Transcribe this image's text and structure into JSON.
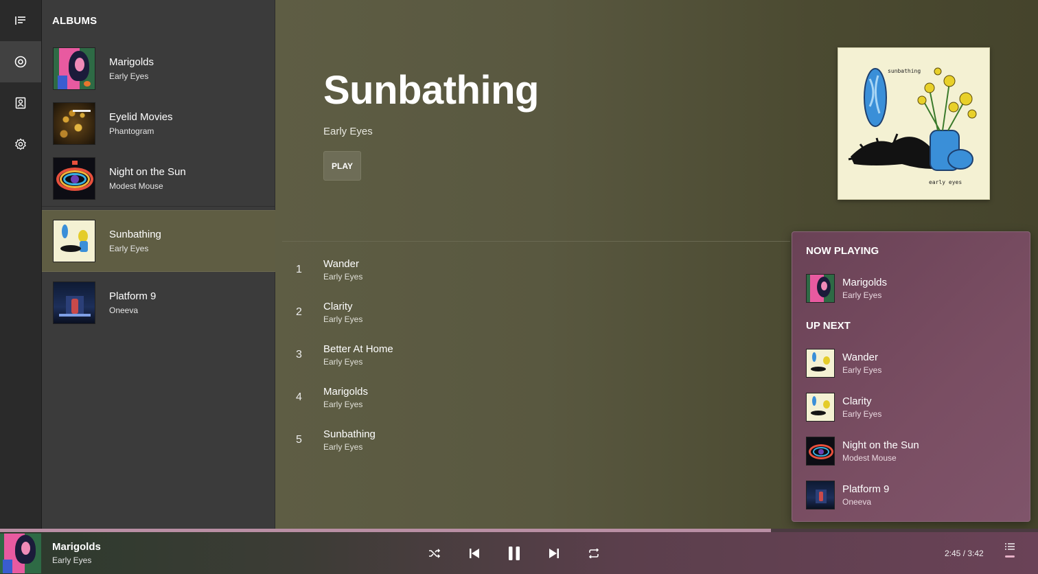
{
  "sidebar": {
    "title": "ALBUMS",
    "albums": [
      {
        "name": "Marigolds",
        "artist": "Early Eyes"
      },
      {
        "name": "Eyelid Movies",
        "artist": "Phantogram"
      },
      {
        "name": "Night on the Sun",
        "artist": "Modest Mouse"
      },
      {
        "name": "Sunbathing",
        "artist": "Early Eyes"
      },
      {
        "name": "Platform 9",
        "artist": "Oneeva"
      }
    ],
    "selected_index": 3
  },
  "rail": {
    "icons": [
      "list-icon",
      "disc-icon",
      "contacts-icon",
      "settings-icon"
    ],
    "active": "disc-icon"
  },
  "album": {
    "title": "Sunbathing",
    "artist": "Early Eyes",
    "play_label": "PLAY",
    "tracks": [
      {
        "num": "1",
        "title": "Wander",
        "artist": "Early Eyes"
      },
      {
        "num": "2",
        "title": "Clarity",
        "artist": "Early Eyes"
      },
      {
        "num": "3",
        "title": "Better At Home",
        "artist": "Early Eyes"
      },
      {
        "num": "4",
        "title": "Marigolds",
        "artist": "Early Eyes"
      },
      {
        "num": "5",
        "title": "Sunbathing",
        "artist": "Early Eyes"
      }
    ]
  },
  "queue": {
    "now_playing_heading": "NOW PLAYING",
    "now_playing": {
      "title": "Marigolds",
      "artist": "Early Eyes"
    },
    "up_next_heading": "UP NEXT",
    "up_next": [
      {
        "title": "Wander",
        "artist": "Early Eyes"
      },
      {
        "title": "Clarity",
        "artist": "Early Eyes"
      },
      {
        "title": "Night on the Sun",
        "artist": "Modest Mouse"
      },
      {
        "title": "Platform 9",
        "artist": "Oneeva"
      }
    ]
  },
  "player": {
    "title": "Marigolds",
    "artist": "Early Eyes",
    "time": "2:45 / 3:42",
    "progress_fraction": 0.743,
    "state": "playing"
  },
  "colors": {
    "accent": "#b98fa4",
    "selected_album_bg": "#5f5d43",
    "queue_panel": "#7a4e63"
  }
}
